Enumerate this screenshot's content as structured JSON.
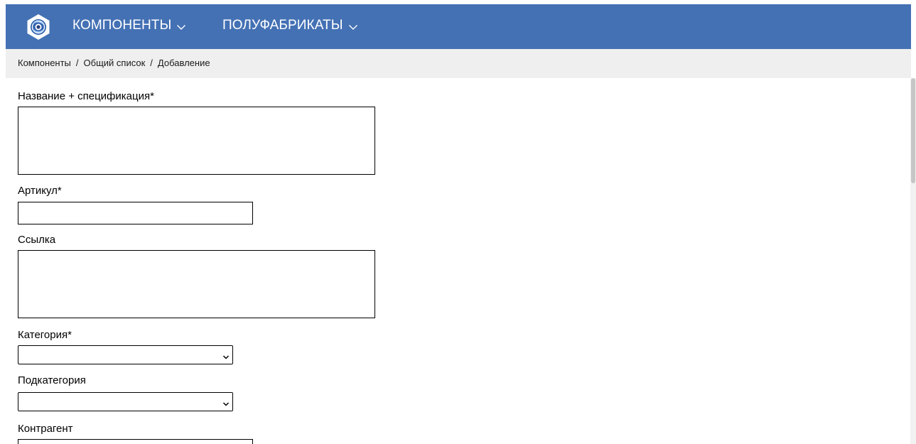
{
  "header": {
    "logo": "company-logo-icon",
    "nav": [
      {
        "label": "КОМПОНЕНТЫ",
        "icon": "chevron-down-icon"
      },
      {
        "label": "ПОЛУФАБРИКАТЫ",
        "icon": "chevron-down-icon"
      }
    ],
    "brand_color": "#4471b4"
  },
  "breadcrumb": {
    "items": [
      "Компоненты",
      "Общий список",
      "Добавление"
    ],
    "separator": "/"
  },
  "form": {
    "fields": [
      {
        "label": "Название + спецификация*",
        "type": "textarea",
        "value": ""
      },
      {
        "label": "Артикул*",
        "type": "text",
        "value": ""
      },
      {
        "label": "Ссылка",
        "type": "textarea",
        "value": ""
      },
      {
        "label": "Категория*",
        "type": "select",
        "value": ""
      },
      {
        "label": "Подкатегория",
        "type": "select",
        "value": ""
      },
      {
        "label": "Контрагент",
        "type": "text",
        "value": ""
      }
    ]
  }
}
